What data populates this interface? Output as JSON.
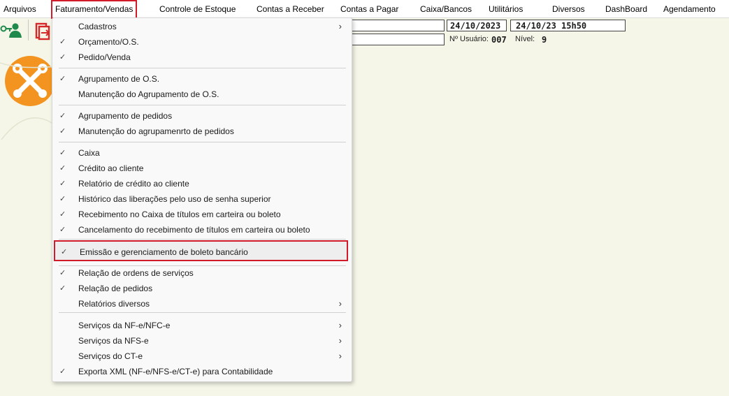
{
  "menubar": {
    "items": [
      "Arquivos",
      "Faturamento/Vendas",
      "Controle de Estoque",
      "Contas a Receber",
      "Contas a Pagar",
      "Caixa/Bancos",
      "Utilitários",
      "Diversos",
      "DashBoard",
      "Agendamento"
    ]
  },
  "header": {
    "date": "24/10/2023",
    "datetime": "24/10/23 15h50",
    "user_label": "Nº Usuário:",
    "user_value": "007",
    "level_label": "Nível:",
    "level_value": "9"
  },
  "icons": {
    "keys": "key-user-icon",
    "exit": "exit-door-icon",
    "tools": "wrench-cross-icon"
  },
  "colors": {
    "highlight_border": "#d11a2a",
    "tools_orange": "#f39420",
    "user_green": "#1f8a4c"
  },
  "dropdown": {
    "items": [
      {
        "label": "Cadastros",
        "check": "",
        "submenu": "›"
      },
      {
        "label": "Orçamento/O.S.",
        "check": "✓",
        "submenu": ""
      },
      {
        "label": "Pedido/Venda",
        "check": "✓",
        "submenu": ""
      },
      {
        "label": "Agrupamento de O.S.",
        "check": "✓",
        "submenu": ""
      },
      {
        "label": "Manutenção do Agrupamento de O.S.",
        "check": "",
        "submenu": ""
      },
      {
        "label": "Agrupamento de pedidos",
        "check": "✓",
        "submenu": ""
      },
      {
        "label": "Manutenção do agrupamenrto de pedidos",
        "check": "✓",
        "submenu": ""
      },
      {
        "label": "Caixa",
        "check": "✓",
        "submenu": ""
      },
      {
        "label": "Crédito ao cliente",
        "check": "✓",
        "submenu": ""
      },
      {
        "label": "Relatório de crédito ao cliente",
        "check": "✓",
        "submenu": ""
      },
      {
        "label": "Histórico das liberações pelo uso de senha superior",
        "check": "✓",
        "submenu": ""
      },
      {
        "label": "Recebimento no Caixa de títulos em carteira ou boleto",
        "check": "✓",
        "submenu": ""
      },
      {
        "label": "Cancelamento do recebimento de títulos em carteira ou boleto",
        "check": "✓",
        "submenu": ""
      },
      {
        "label": "Emissão e gerenciamento de boleto bancário",
        "check": "✓",
        "submenu": ""
      },
      {
        "label": "Relação de ordens de serviços",
        "check": "✓",
        "submenu": ""
      },
      {
        "label": "Relação de pedidos",
        "check": "✓",
        "submenu": ""
      },
      {
        "label": "Relatórios diversos",
        "check": "",
        "submenu": "›"
      },
      {
        "label": "Serviços da NF-e/NFC-e",
        "check": "",
        "submenu": "›"
      },
      {
        "label": "Serviços da NFS-e",
        "check": "",
        "submenu": "›"
      },
      {
        "label": "Serviços do CT-e",
        "check": "",
        "submenu": "›"
      },
      {
        "label": "Exporta XML (NF-e/NFS-e/CT-e) para Contabilidade",
        "check": "✓",
        "submenu": ""
      }
    ]
  }
}
